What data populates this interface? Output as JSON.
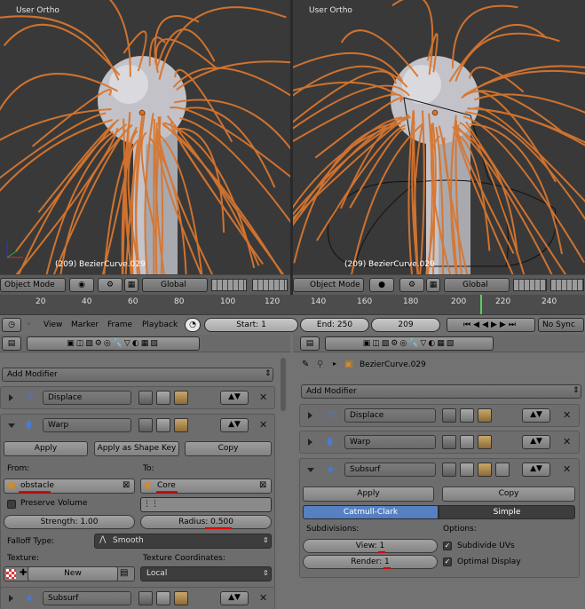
{
  "left_viewport": {
    "view_label": "User Ortho",
    "object_label": "(209) BezierCurve.029"
  },
  "right_viewport": {
    "view_label": "User Ortho",
    "object_label": "(209) BezierCurve.029"
  },
  "left_header": {
    "mode": "Object Mode",
    "orientation": "Global"
  },
  "right_header": {
    "mode": "Object Mode",
    "orientation": "Global"
  },
  "ruler": {
    "ticks": [
      "20",
      "40",
      "60",
      "80",
      "100",
      "120",
      "140",
      "160",
      "180",
      "200",
      "220",
      "240"
    ]
  },
  "timeline": {
    "menus": [
      "View",
      "Marker",
      "Frame",
      "Playback"
    ],
    "start_label": "Start: 1",
    "end_label": "End: 250",
    "current_frame": "209",
    "sync": "No Sync"
  },
  "left_panel": {
    "add_modifier": "Add Modifier",
    "modifiers": [
      "Displace",
      "Warp",
      "Subsurf"
    ],
    "warp": {
      "apply": "Apply",
      "apply_shape": "Apply as Shape Key",
      "copy": "Copy",
      "from_label": "From:",
      "to_label": "To:",
      "from_value": "obstacle",
      "to_value": "Core",
      "preserve_volume": "Preserve Volume",
      "strength": "Strength: 1.00",
      "radius": "Radius: 0.500",
      "falloff_label": "Falloff Type:",
      "falloff_value": "Smooth",
      "texture_label": "Texture:",
      "texcoords_label": "Texture Coordinates:",
      "new_button": "New",
      "texcoords_value": "Local"
    }
  },
  "right_panel": {
    "object_name": "BezierCurve.029",
    "add_modifier": "Add Modifier",
    "modifiers": [
      "Displace",
      "Warp",
      "Subsurf"
    ],
    "subsurf": {
      "apply": "Apply",
      "copy": "Copy",
      "tab_catmull": "Catmull-Clark",
      "tab_simple": "Simple",
      "subdivisions_label": "Subdivisions:",
      "options_label": "Options:",
      "view": "View: 1",
      "render": "Render: 1",
      "subdivide_uvs": "Subdivide UVs",
      "optimal_display": "Optimal Display"
    }
  },
  "colors": {
    "hair": "#d8762f",
    "viewport_bg": "#393939",
    "active_tab": "#5680c2"
  }
}
